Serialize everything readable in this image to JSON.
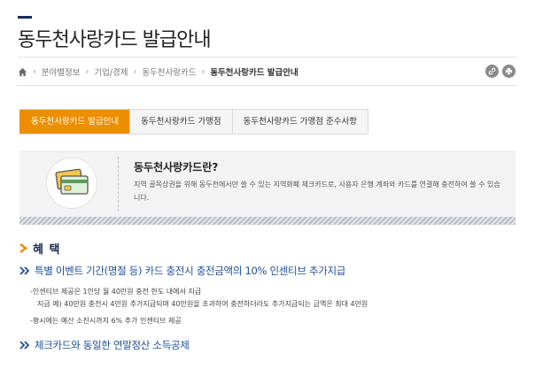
{
  "page": {
    "title": "동두천사랑카드 발급안내"
  },
  "breadcrumb": {
    "items": [
      "분야별정보",
      "기업/경제",
      "동두천사랑카드"
    ],
    "current": "동두천사랑카드 발급안내"
  },
  "actions": {
    "icons": [
      "link-icon",
      "print-icon"
    ]
  },
  "tabs": [
    {
      "label": "동두천사랑카드 발급안내",
      "active": true
    },
    {
      "label": "동두천사랑카드 가맹점",
      "active": false
    },
    {
      "label": "동두천사랑카드 가맹점 준수사항",
      "active": false
    }
  ],
  "info": {
    "heading": "동두천사랑카드란?",
    "desc": "지역 골목상권을 위해 동두천에서만 쓸 수 있는 지역화폐 체크카드로, 사용자 은행 계좌와 카드를 연결해 충전하여 쓸 수 있습니다."
  },
  "section": {
    "heading": "혜 택"
  },
  "benefits": [
    {
      "title": "특별 이벤트 기간(명절 등) 카드 충전시 충전금액의 10% 인센티브 추가지급",
      "bullets": [
        "인센티브 제공은 1인당 월 40만원 충전 한도 내에서 지급",
        "지급 예) 40만원 충전시 4만원 추가지급되며 40만원을 초과하여 충전하더라도 추가지급되는 금액은 최대 4만원",
        "평시에는 예산 소진시까지 6% 추가 인센티브 제공"
      ]
    },
    {
      "title": "체크카드와 동일한 연말정산 소득공제"
    }
  ],
  "colors": {
    "accent": "#ec8e00",
    "navy": "#1b2a4e",
    "link_blue": "#1d4f9c"
  }
}
